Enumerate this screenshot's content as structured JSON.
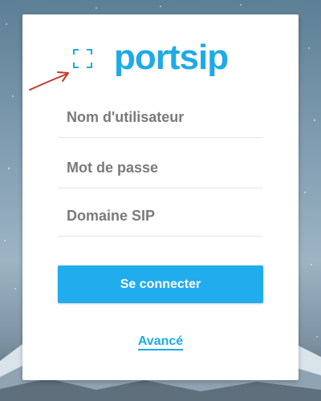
{
  "app": {
    "logo_text": "portsip",
    "brand_color": "#1eaae7"
  },
  "login": {
    "username_placeholder": "Nom d'utilisateur",
    "password_placeholder": "Mot de passe",
    "domain_placeholder": "Domaine SIP",
    "username_value": "",
    "password_value": "",
    "domain_value": "",
    "connect_label": "Se connecter",
    "connect_color": "#21acee",
    "advanced_label": "Avancé"
  },
  "icons": {
    "scan": "qr-scan-icon",
    "annotation": "red-arrow-annotation"
  }
}
